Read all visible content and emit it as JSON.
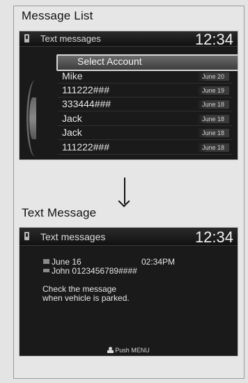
{
  "section1": {
    "heading": "Message List",
    "header": {
      "title": "Text messages",
      "time": "12:34"
    },
    "select_account": "Select Account",
    "rows": [
      {
        "name": "Mike",
        "date": "June 20"
      },
      {
        "name": "111222###",
        "date": "June 19"
      },
      {
        "name": "333444###",
        "date": "June 18"
      },
      {
        "name": "Jack",
        "date": "June 18"
      },
      {
        "name": "Jack",
        "date": "June 18"
      },
      {
        "name": "111222###",
        "date": "June 18"
      }
    ]
  },
  "section2": {
    "heading": "Text Message",
    "header": {
      "title": "Text messages",
      "time": "12:34"
    },
    "date": "June 16",
    "time": "02:34PM",
    "sender": "John 0123456789####",
    "body_line1": "Check the message",
    "body_line2": "when vehicle is parked.",
    "footer": "Push MENU"
  },
  "icons": {
    "phone": "phone-icon",
    "arrow": "arrow-down-icon",
    "calendar": "calendar-icon",
    "contact": "contact-icon",
    "menu_person": "person-icon"
  },
  "colors": {
    "screen_bg": "#1a1a1a",
    "page_bg": "#e4e4e4",
    "text_light": "#e8e8e8"
  }
}
